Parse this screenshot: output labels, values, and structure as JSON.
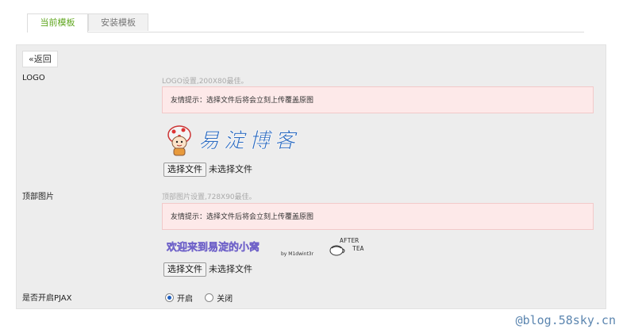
{
  "tabs": [
    {
      "label": "当前模板",
      "active": true
    },
    {
      "label": "安装模板",
      "active": false
    }
  ],
  "back_button": "«返回",
  "logo_section": {
    "label": "LOGO",
    "hint": "LOGO设置,200X80最佳。",
    "notice": "友情提示：选择文件后将会立刻上传覆盖原图",
    "image_text": "易淀博客",
    "file_button": "选择文件",
    "file_status": "未选择文件"
  },
  "header_section": {
    "label": "顶部图片",
    "hint": "顶部图片设置,728X90最佳。",
    "notice": "友情提示：选择文件后将会立刻上传覆盖原图",
    "banner_text": "欢迎来到易淀的小窝",
    "banner_by": "by M1dwint3r",
    "banner_after": "AFTER",
    "banner_tea": "TEA",
    "file_button": "选择文件",
    "file_status": "未选择文件"
  },
  "pjax_section": {
    "label": "是否开启PJAX",
    "options": [
      {
        "label": "开启",
        "selected": true
      },
      {
        "label": "关闭",
        "selected": false
      }
    ]
  },
  "watermark": "@blog.58sky.cn",
  "colors": {
    "accent": "#5fa61e",
    "notice_bg": "#fde9e9",
    "panel_bg": "#ededed",
    "logo_text": "#2d6bbf",
    "banner_text": "#8d7fe0"
  }
}
